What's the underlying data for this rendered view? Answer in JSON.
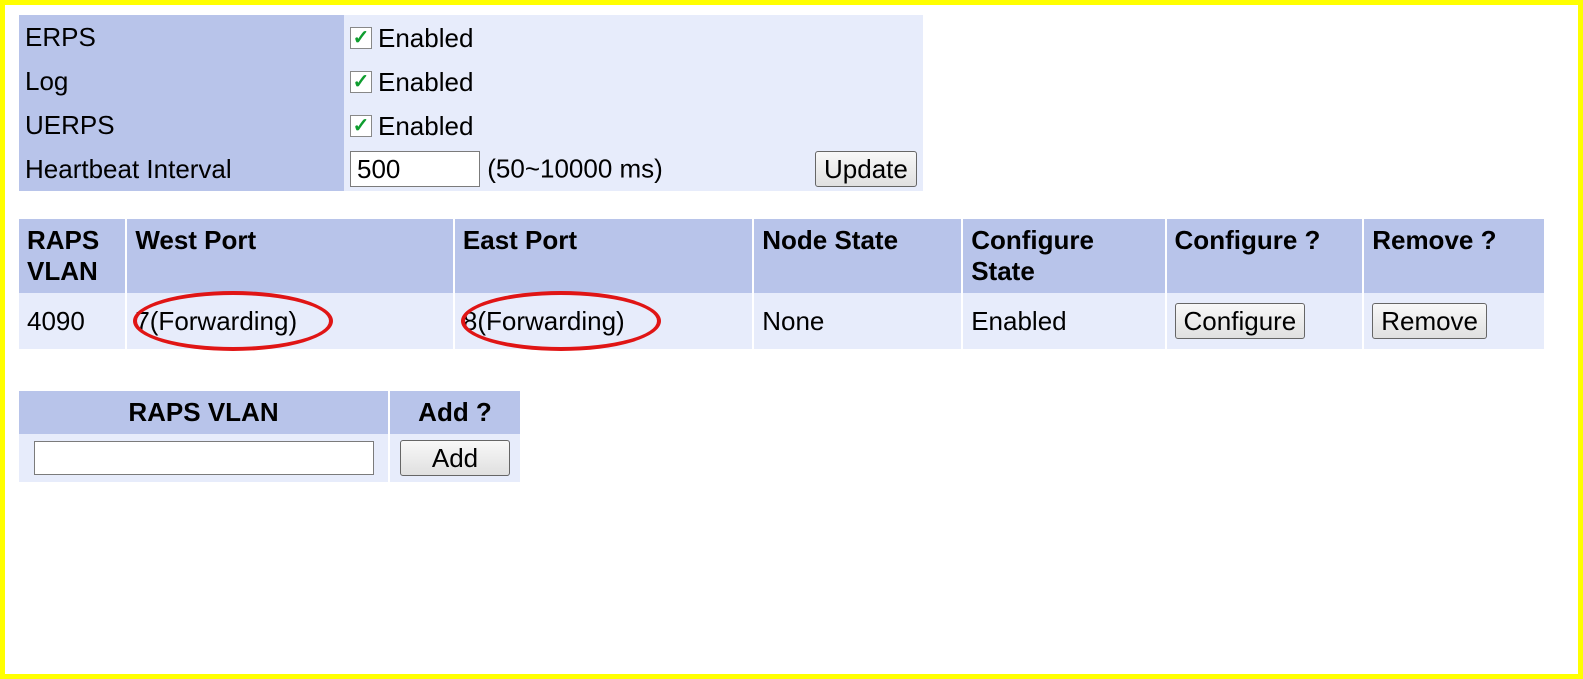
{
  "settings": {
    "erps": {
      "label": "ERPS",
      "enabled_text": "Enabled",
      "checked": true
    },
    "log": {
      "label": "Log",
      "enabled_text": "Enabled",
      "checked": true
    },
    "uerps": {
      "label": "UERPS",
      "enabled_text": "Enabled",
      "checked": true
    },
    "heartbeat": {
      "label": "Heartbeat Interval",
      "value": "500",
      "hint": "(50~10000 ms)",
      "update_label": "Update"
    }
  },
  "headers": {
    "raps_vlan": "RAPS VLAN",
    "west_port": "West Port",
    "east_port": "East Port",
    "node_state": "Node State",
    "configure_state": "Configure State",
    "configure_q": "Configure ?",
    "remove_q": "Remove ?"
  },
  "rows": [
    {
      "vlan": "4090",
      "west": "7(Forwarding)",
      "east": "8(Forwarding)",
      "node_state": "None",
      "cfg_state": "Enabled",
      "configure_btn": "Configure",
      "remove_btn": "Remove"
    }
  ],
  "add": {
    "vlan_header": "RAPS VLAN",
    "add_header": "Add ?",
    "vlan_value": "",
    "add_label": "Add"
  }
}
